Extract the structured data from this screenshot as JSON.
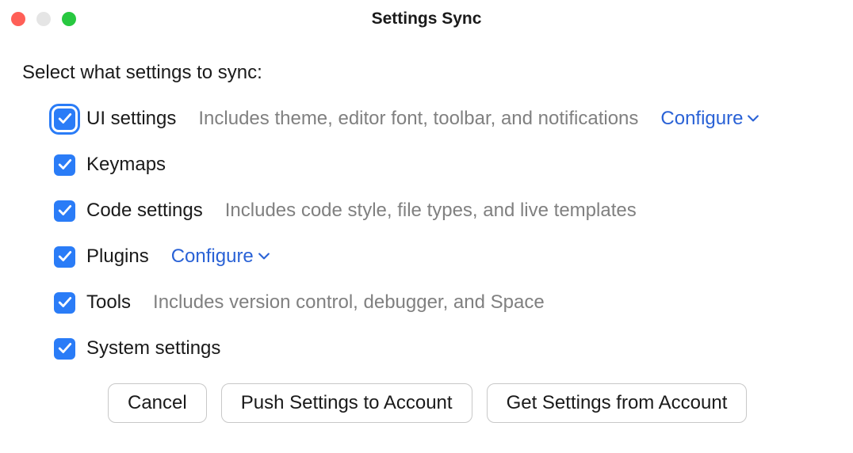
{
  "window": {
    "title": "Settings Sync"
  },
  "prompt": "Select what settings to sync:",
  "settings": [
    {
      "label": "UI settings",
      "description": "Includes theme, editor font, toolbar, and notifications",
      "configure": "Configure",
      "checked": true,
      "focused": true
    },
    {
      "label": "Keymaps",
      "description": "",
      "configure": "",
      "checked": true,
      "focused": false
    },
    {
      "label": "Code settings",
      "description": "Includes code style, file types, and live templates",
      "configure": "",
      "checked": true,
      "focused": false
    },
    {
      "label": "Plugins",
      "description": "",
      "configure": "Configure",
      "checked": true,
      "focused": false
    },
    {
      "label": "Tools",
      "description": "Includes version control, debugger, and Space",
      "configure": "",
      "checked": true,
      "focused": false
    },
    {
      "label": "System settings",
      "description": "",
      "configure": "",
      "checked": true,
      "focused": false
    }
  ],
  "buttons": {
    "cancel": "Cancel",
    "push": "Push Settings to Account",
    "get": "Get Settings from Account"
  }
}
